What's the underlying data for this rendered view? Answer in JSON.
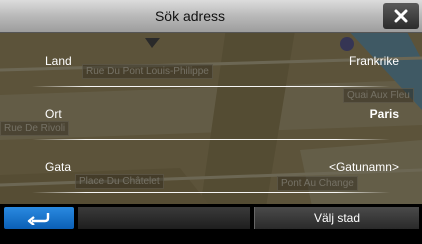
{
  "header": {
    "title": "Sök adress",
    "close_icon": "close-icon"
  },
  "map": {
    "street_labels": [
      "Rue Du Pont Louis-Philippe",
      "Quai Aux Fleu",
      "Rue De Rivoli",
      "Place Du Châtelet",
      "Pont Au Change"
    ]
  },
  "fields": [
    {
      "label": "Land",
      "value": "Frankrike"
    },
    {
      "label": "Ort",
      "value": "Paris"
    },
    {
      "label": "Gata",
      "value": "<Gatunamn>"
    }
  ],
  "footer": {
    "back_icon": "back-arrow-icon",
    "select_city_label": "Välj stad"
  },
  "colors": {
    "accent": "#1a78d0",
    "header_bg": "#c4c4c4"
  }
}
